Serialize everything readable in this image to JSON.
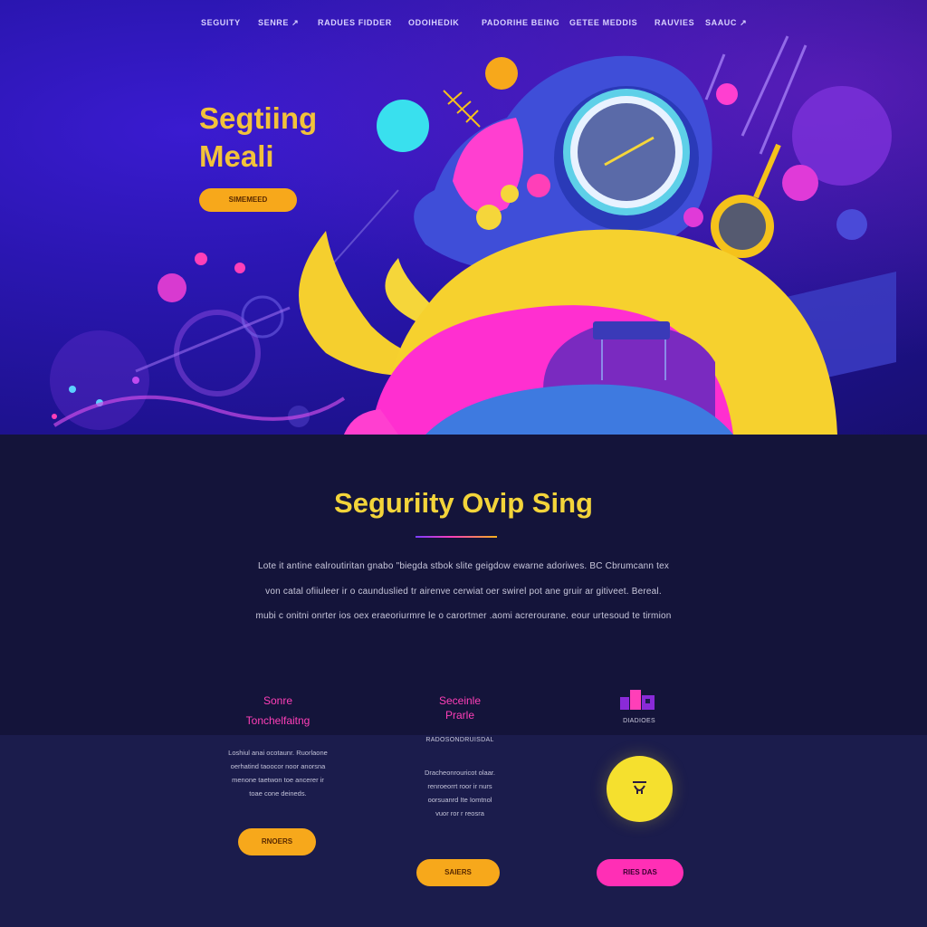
{
  "nav": {
    "items": [
      {
        "label": "SEGUITY"
      },
      {
        "label": "SENRE ↗"
      },
      {
        "label": "RADUES FIDDER"
      },
      {
        "label": "ODOIHEDIK"
      },
      {
        "label": "PADORIHE BEING"
      },
      {
        "label": "GETEE MEDDIS"
      },
      {
        "label": "RAUVIES"
      },
      {
        "label": "SAAUC ↗"
      }
    ]
  },
  "hero": {
    "title_line1": "Segtiing",
    "title_line2": "Meali",
    "button_label": "SIMEMEED"
  },
  "section": {
    "title": "Seguriity Ovip Sing",
    "description": [
      "Lote it antine ealroutiritan gnabo \"biegda stbok slite geigdow ewarne adoriwes. BC Cbrumcann tex",
      "von catal ofiiuleer ir o caunduslied tr airenve cerwiat oer swirel pot ane gruir ar gitiveet. Bereal.",
      "mubi c onitni onrter ios oex eraeoriurmre le o carortmer .aomi acrerourane. eour urtesoud te tirmion"
    ]
  },
  "features": [
    {
      "title_line1": "Sonre",
      "title_line2": "Tonchelfaitng",
      "text_lines": [
        "Loshiul anai ocotaunr. Ruorlaone",
        "oerhatind taoocor noor anorsna",
        "menone taetwon toe ancerer ir",
        "toae cone deineds."
      ],
      "button_label": "RNOERS"
    },
    {
      "title_line1": "Seceinle",
      "title_line2": "Prarle",
      "subtitle": "RADOSONDRUISDAL",
      "text_lines": [
        "Dracheonrouricot olaar.",
        "renroeorrt roor ir nurs",
        "oorsuanrd Ite Iomtnol",
        "vuor ror r reosra"
      ],
      "button_label": "SAIERS"
    },
    {
      "icon_label": "DIADIOES",
      "button_label": "RIES DAS"
    }
  ],
  "colors": {
    "accent_yellow": "#f3d43a",
    "accent_orange": "#f7a81b",
    "accent_pink": "#ff3fb8",
    "bg_dark": "#14143a",
    "hero_purple": "#2a16b0"
  }
}
